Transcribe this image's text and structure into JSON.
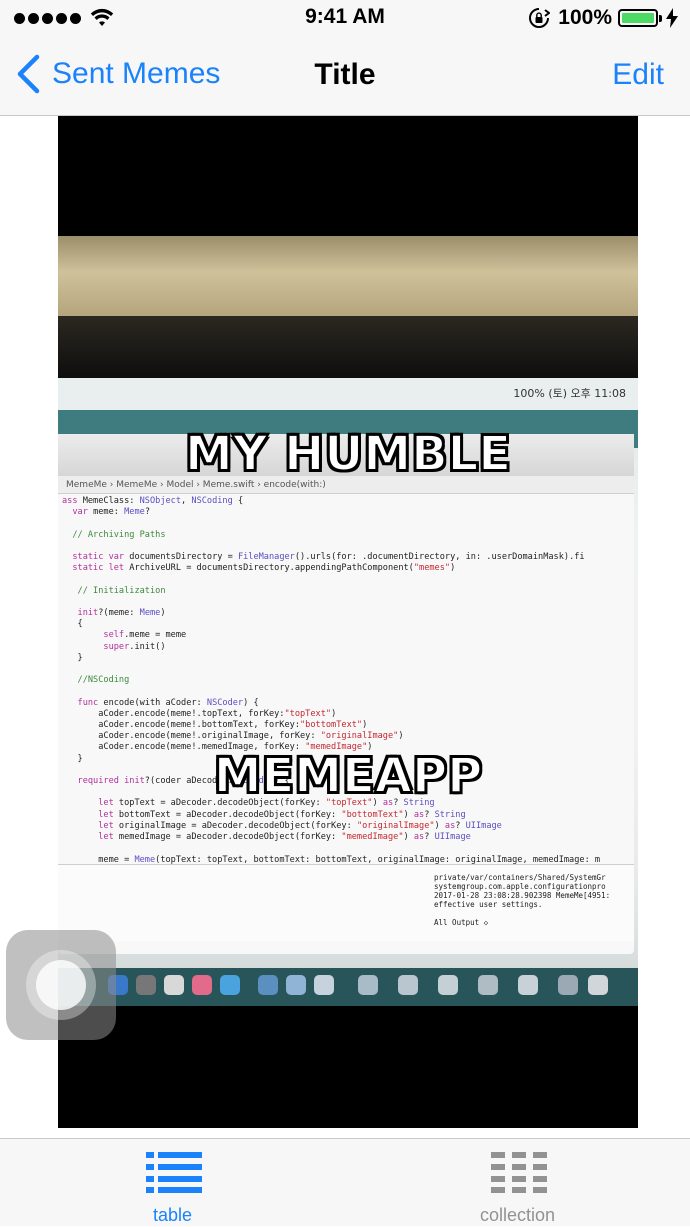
{
  "status_bar": {
    "time": "9:41 AM",
    "battery_percent": "100%",
    "signal_bars": 5,
    "icons": [
      "wifi-icon",
      "rotation-lock-icon",
      "battery-icon",
      "charging-icon"
    ]
  },
  "nav_bar": {
    "back_label": "Sent Memes",
    "title": "Title",
    "edit_label": "Edit"
  },
  "meme": {
    "top_text": "MY HUMBLE",
    "bottom_text": "MEMEAPP",
    "photo_menubar": "100%  (토) 오후 11:08",
    "photo_path": "MemeMe  ›  MemeMe  ›  Model  ›  Meme.swift  ›  encode(with:)",
    "debug_text": "private/var/containers/Shared/SystemGr\nsystemgroup.com.apple.configurationpro\n2017-01-28 23:08:28.902398 MemeMe[4951:\neffective user settings.\n\nAll Output ◇"
  },
  "tab_bar": {
    "items": [
      {
        "label": "table",
        "icon": "list-icon",
        "selected": true
      },
      {
        "label": "collection",
        "icon": "grid-icon",
        "selected": false
      }
    ]
  },
  "colors": {
    "tint": "#1a82fb",
    "inactive_tab": "#929292",
    "bar_background": "#f7f7f7",
    "battery_green": "#4cd964"
  }
}
